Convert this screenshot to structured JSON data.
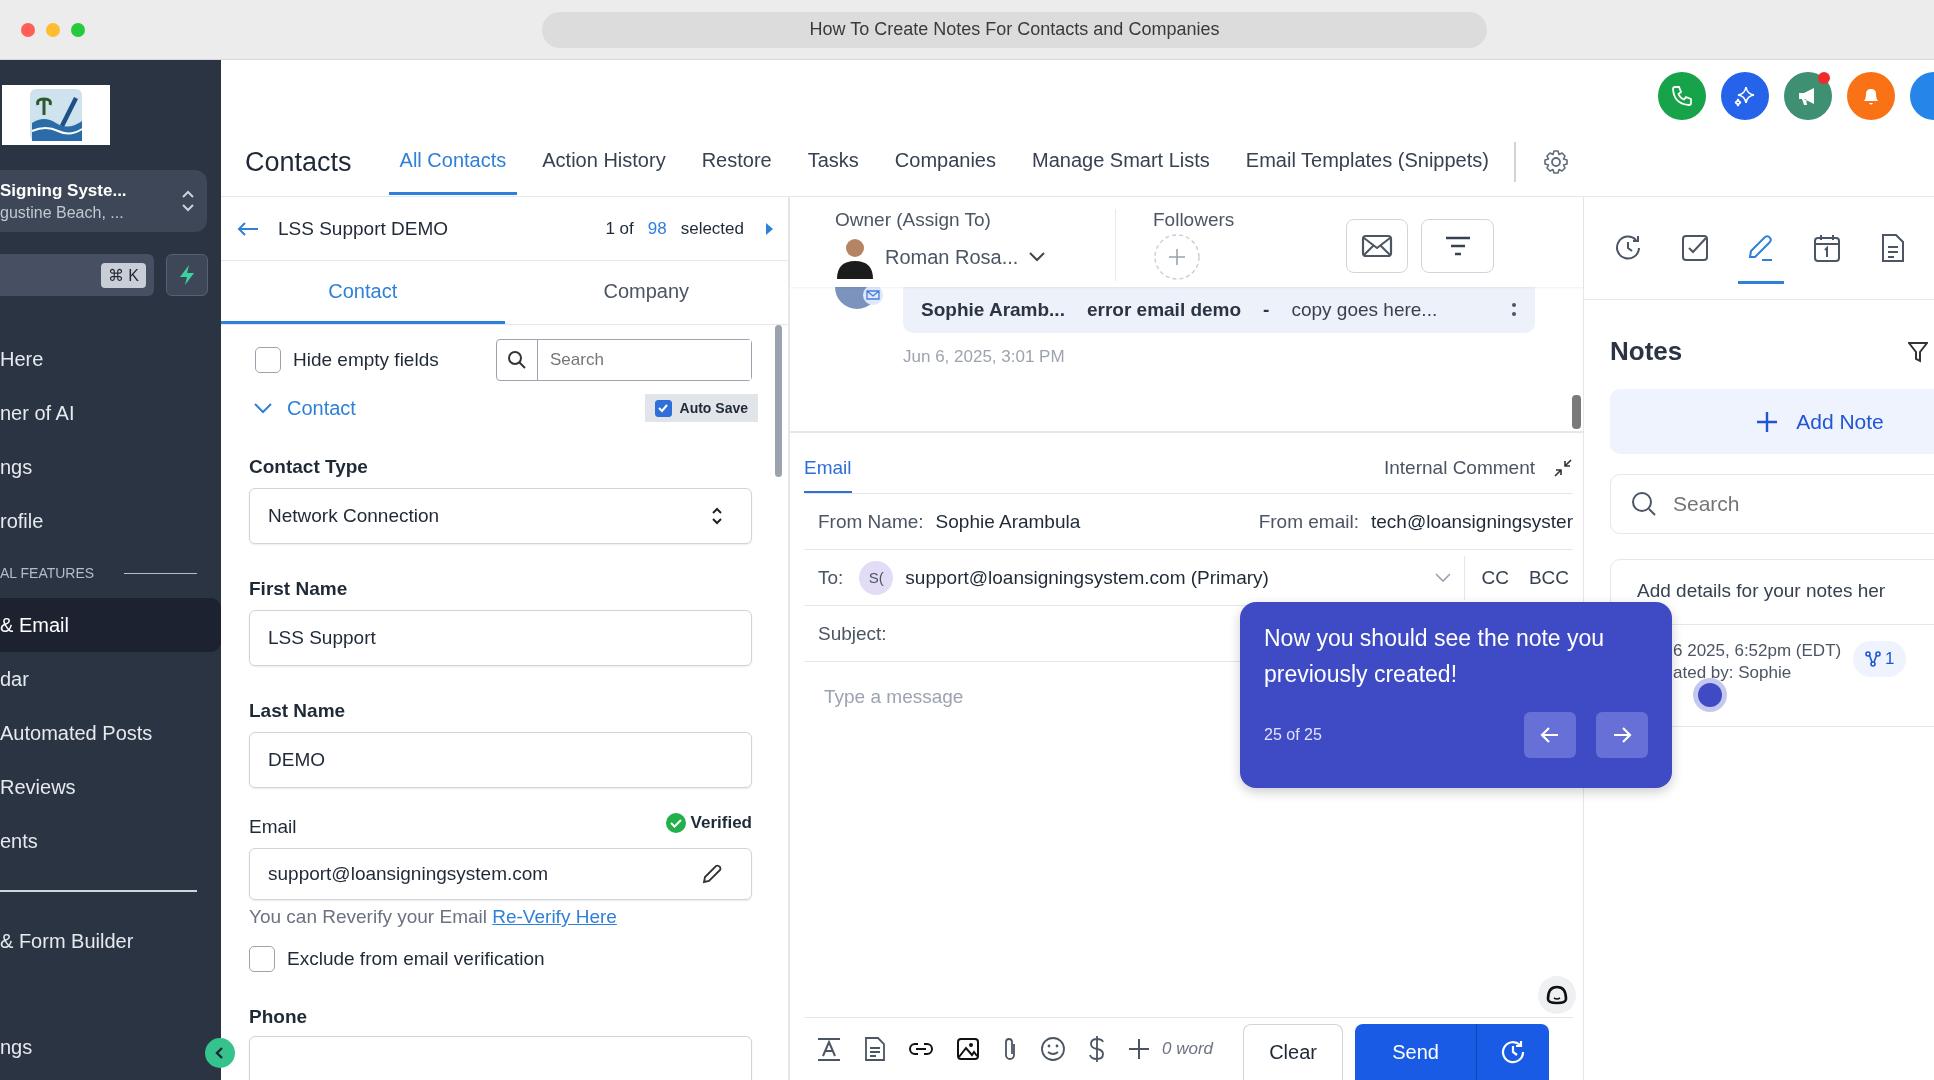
{
  "browser": {
    "title": "How To Create Notes For Contacts and Companies"
  },
  "sidebar": {
    "account": {
      "name": "Signing Syste...",
      "location": "gustine Beach, ..."
    },
    "search_shortcut": "⌘ K",
    "items": [
      {
        "kind": "item",
        "label": "Here",
        "selected": false
      },
      {
        "kind": "item",
        "label": "ner of AI",
        "selected": false
      },
      {
        "kind": "item",
        "label": "ngs",
        "selected": false
      },
      {
        "kind": "item",
        "label": "rofile",
        "selected": false
      },
      {
        "kind": "section",
        "label": "AL FEATURES"
      },
      {
        "kind": "item",
        "label": "& Email",
        "selected": true
      },
      {
        "kind": "item",
        "label": "dar",
        "selected": false
      },
      {
        "kind": "item",
        "label": "Automated Posts",
        "selected": false
      },
      {
        "kind": "item",
        "label": "Reviews",
        "selected": false
      },
      {
        "kind": "item",
        "label": "ents",
        "selected": false
      },
      {
        "kind": "divider"
      },
      {
        "kind": "item",
        "label": "& Form Builder",
        "selected": false
      },
      {
        "kind": "item",
        "label": "ngs",
        "selected": false
      }
    ]
  },
  "header": {
    "title": "Contacts",
    "tabs": [
      {
        "label": "All Contacts",
        "selected": true
      },
      {
        "label": "Action History",
        "selected": false
      },
      {
        "label": "Restore",
        "selected": false
      },
      {
        "label": "Tasks",
        "selected": false
      },
      {
        "label": "Companies",
        "selected": false
      },
      {
        "label": "Manage Smart Lists",
        "selected": false
      },
      {
        "label": "Email Templates (Snippets)",
        "selected": false
      }
    ],
    "action_buttons": [
      {
        "kind": "phone",
        "color": "#16a34a",
        "notification": false
      },
      {
        "kind": "sparkle",
        "color": "#2563eb",
        "notification": false
      },
      {
        "kind": "megaphone",
        "color": "#3f8f72",
        "notification": true
      },
      {
        "kind": "bell",
        "color": "#f97316",
        "notification": false
      },
      {
        "kind": "partial",
        "color": "#2585e8"
      }
    ]
  },
  "contact_panel": {
    "name": "LSS Support DEMO",
    "position": "1 of",
    "count": "98",
    "count_suffix": "selected",
    "tabs": [
      {
        "label": "Contact",
        "selected": true
      },
      {
        "label": "Company",
        "selected": false
      }
    ],
    "hide_empty": {
      "label": "Hide empty fields",
      "checked": false
    },
    "search": {
      "placeholder": "Search"
    },
    "section": {
      "label": "Contact",
      "expanded": true
    },
    "auto_save": {
      "label": "Auto Save",
      "checked": true
    },
    "contact_type": {
      "label": "Contact Type",
      "value": "Network Connection"
    },
    "first_name": {
      "label": "First Name",
      "value": "LSS Support"
    },
    "last_name": {
      "label": "Last Name",
      "value": "DEMO"
    },
    "email": {
      "label": "Email",
      "verified": "Verified",
      "value": "support@loansigningsystem.com"
    },
    "reverify": {
      "text": "You can Reverify your Email",
      "link": "Re-Verify Here"
    },
    "exclude": {
      "label": "Exclude from email verification",
      "checked": false
    },
    "phone": {
      "label": "Phone"
    }
  },
  "conversation": {
    "owner_label": "Owner (Assign To)",
    "owner": "Roman Rosa...",
    "followers_label": "Followers",
    "message": {
      "sender": "Sophie Aramb...",
      "subject": "error email demo",
      "separator": "-",
      "preview": "copy goes here..."
    },
    "date": "Jun 6, 2025, 3:01 PM"
  },
  "composer": {
    "tabs": [
      {
        "label": "Email",
        "selected": true
      },
      {
        "label": "Internal Comment",
        "selected": false
      }
    ],
    "from_name_label": "From Name:",
    "from_name": "Sophie Arambula",
    "from_email_label": "From email:",
    "from_email": "tech@loansigningsyster",
    "to_label": "To:",
    "to_initials": "S(",
    "to": "support@loansigningsystem.com (Primary)",
    "cc": "CC",
    "bcc": "BCC",
    "subject_label": "Subject:",
    "placeholder": "Type a message",
    "word_count": "0 word",
    "clear": "Clear",
    "send": "Send"
  },
  "tour": {
    "text": "Now you should see the note you previously created!",
    "step": "25 of 25"
  },
  "notes_panel": {
    "tabs": [
      {
        "kind": "activity",
        "selected": false
      },
      {
        "kind": "task",
        "selected": false
      },
      {
        "kind": "note",
        "selected": true
      },
      {
        "kind": "calendar",
        "selected": false
      },
      {
        "kind": "document",
        "selected": false
      }
    ],
    "title": "Notes",
    "add": "Add Note",
    "search": {
      "placeholder": "Search"
    },
    "note": {
      "body": "Add details for your notes her",
      "date": "6 2025, 6:52pm (EDT)",
      "author": "ated by: Sophie",
      "share_count": "1"
    }
  }
}
